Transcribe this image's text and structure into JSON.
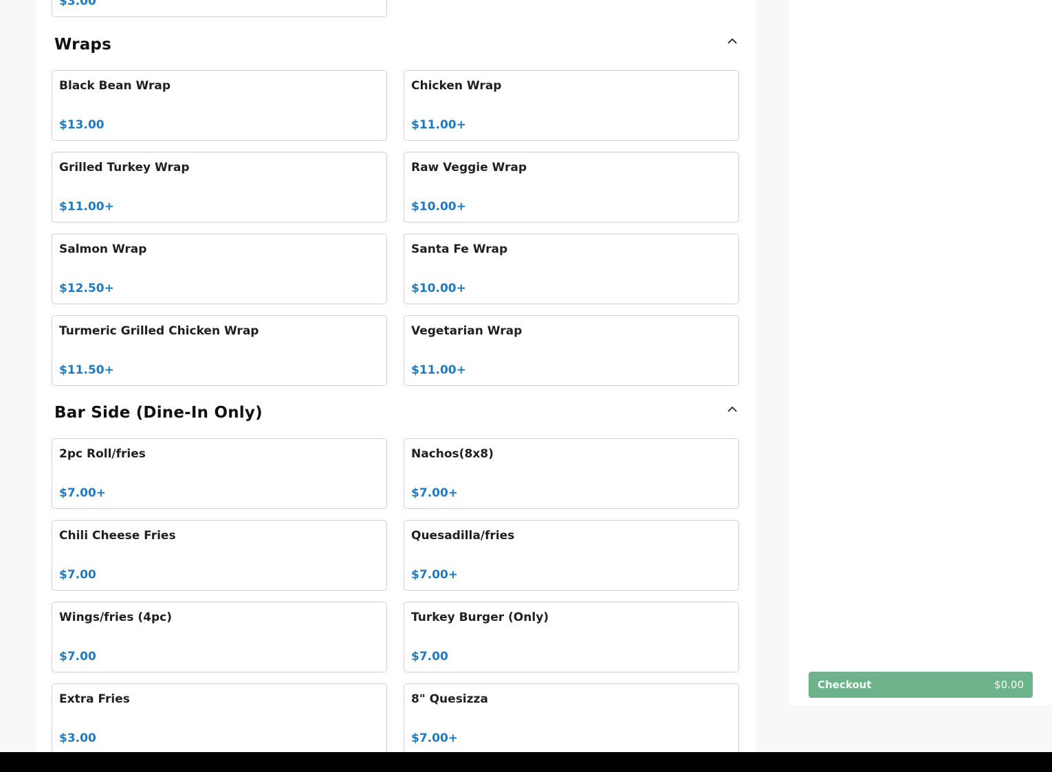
{
  "top_partial_price": "$3.00",
  "sections": [
    {
      "title": "Wraps",
      "items": [
        {
          "name": "Black Bean Wrap",
          "price": "$13.00"
        },
        {
          "name": "Chicken Wrap",
          "price": "$11.00+"
        },
        {
          "name": "Grilled Turkey Wrap",
          "price": "$11.00+"
        },
        {
          "name": "Raw Veggie Wrap",
          "price": "$10.00+"
        },
        {
          "name": "Salmon Wrap",
          "price": "$12.50+"
        },
        {
          "name": "Santa Fe Wrap",
          "price": "$10.00+"
        },
        {
          "name": "Turmeric Grilled Chicken Wrap",
          "price": "$11.50+"
        },
        {
          "name": "Vegetarian Wrap",
          "price": "$11.00+"
        }
      ]
    },
    {
      "title": "Bar Side (Dine-In Only)",
      "items": [
        {
          "name": "2pc Roll/fries",
          "price": "$7.00+"
        },
        {
          "name": "Nachos(8x8)",
          "price": "$7.00+"
        },
        {
          "name": "Chili Cheese Fries",
          "price": "$7.00"
        },
        {
          "name": "Quesadilla/fries",
          "price": "$7.00+"
        },
        {
          "name": "Wings/fries (4pc)",
          "price": "$7.00"
        },
        {
          "name": "Turkey Burger (Only)",
          "price": "$7.00"
        },
        {
          "name": "Extra Fries",
          "price": "$3.00"
        },
        {
          "name": "8\" Quesizza",
          "price": "$7.00+"
        }
      ]
    }
  ],
  "checkout": {
    "label": "Checkout",
    "total": "$0.00"
  },
  "icons": {
    "collapse": "chevron-up-icon"
  },
  "colors": {
    "price": "#1f7ac4",
    "checkout_bg": "#6cb28a"
  }
}
